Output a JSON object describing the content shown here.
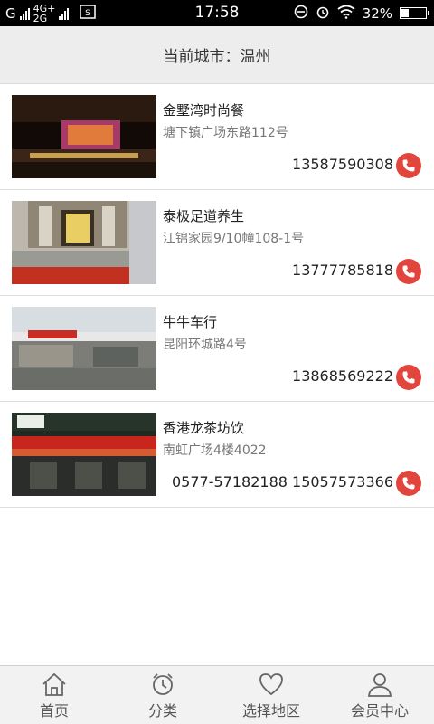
{
  "status_bar": {
    "carrier_g": "G",
    "net_top": "4G+",
    "net_bottom": "2G",
    "time": "17:58",
    "battery_pct": "32%",
    "battery_level": 0.32
  },
  "header": {
    "city_label": "当前城市：温州"
  },
  "shops": [
    {
      "name": "金墅湾时尚餐",
      "address": "塘下镇广场东路112号",
      "phone": "13587590308",
      "image": "restaurant-storefront-night"
    },
    {
      "name": "泰极足道养生",
      "address": "江锦家园9/10幢108-1号",
      "phone": "13777785818",
      "image": "foot-massage-storefront"
    },
    {
      "name": "牛牛车行",
      "address": "昆阳环城路4号",
      "phone": "13868569222",
      "image": "car-shop-storefront"
    },
    {
      "name": "香港龙茶坊饮",
      "address": "南虹广场4楼4022",
      "phone": "0577-57182188 15057573366",
      "image": "tea-shop-storefront"
    }
  ],
  "tabs": [
    {
      "label": "首页",
      "icon": "home-icon"
    },
    {
      "label": "分类",
      "icon": "alarm-clock-icon"
    },
    {
      "label": "选择地区",
      "icon": "heart-icon"
    },
    {
      "label": "会员中心",
      "icon": "user-icon"
    }
  ],
  "colors": {
    "call_button": "#e2453c",
    "header_bg": "#ededed",
    "tab_bg": "#f2f2f2"
  }
}
